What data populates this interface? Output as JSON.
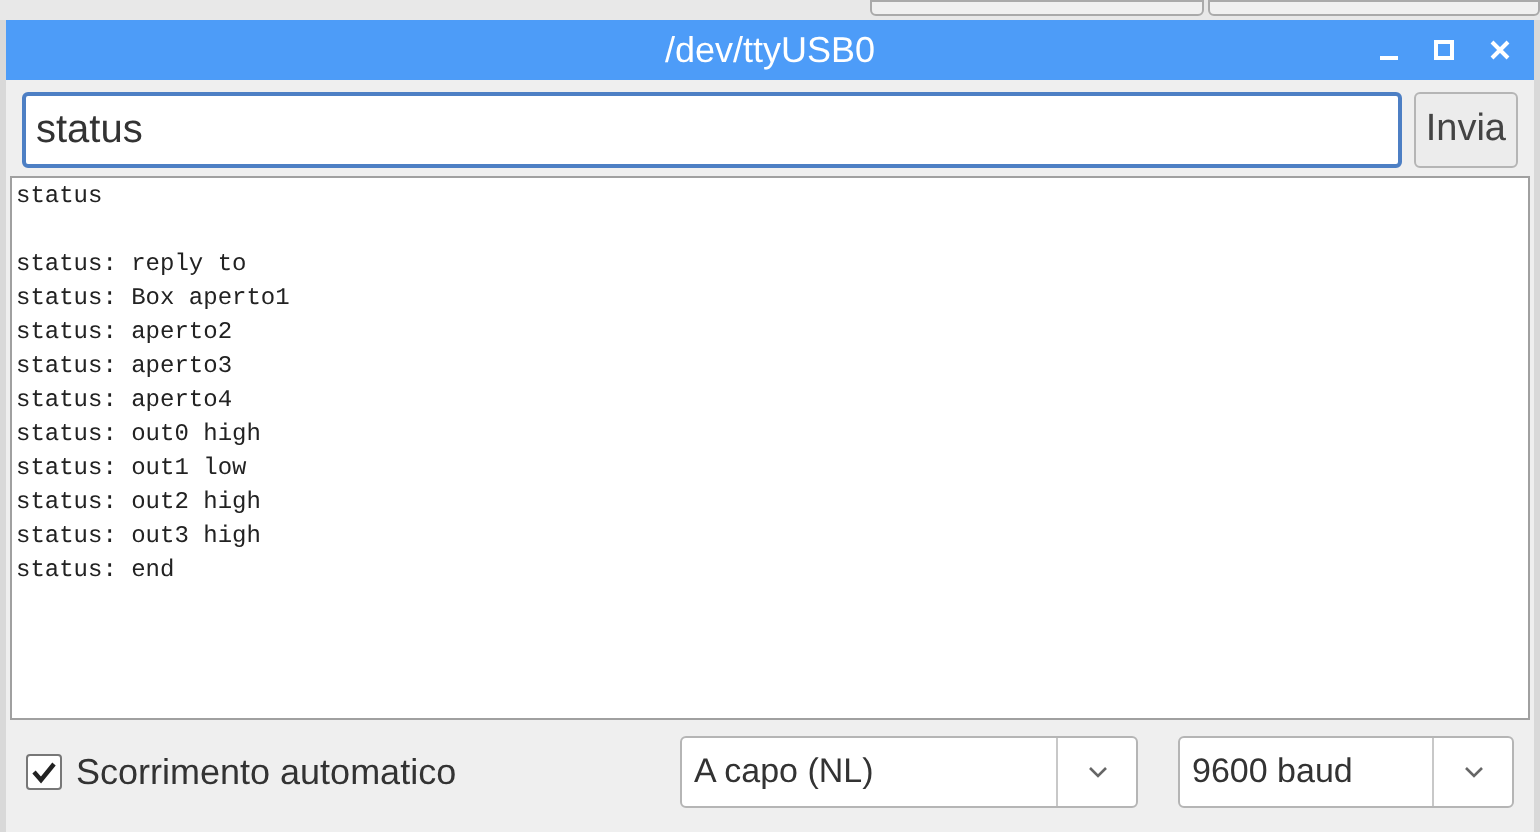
{
  "window": {
    "title": "/dev/ttyUSB0"
  },
  "send": {
    "value": "status",
    "button": "Invia"
  },
  "output": [
    {
      "kind": "echo",
      "text": "status"
    },
    {
      "kind": "reply",
      "text": "status: reply to"
    },
    {
      "kind": "reply",
      "text": "status: Box aperto1"
    },
    {
      "kind": "reply",
      "text": "status: aperto2"
    },
    {
      "kind": "reply",
      "text": "status: aperto3"
    },
    {
      "kind": "reply",
      "text": "status: aperto4"
    },
    {
      "kind": "reply",
      "text": "status: out0 high"
    },
    {
      "kind": "reply",
      "text": "status: out1 low"
    },
    {
      "kind": "reply",
      "text": "status: out2 high"
    },
    {
      "kind": "reply",
      "text": "status: out3 high"
    },
    {
      "kind": "reply",
      "text": "status: end"
    }
  ],
  "footer": {
    "autoscroll": {
      "label": "Scorrimento automatico",
      "checked": true
    },
    "line_ending": "A capo (NL)",
    "baud": "9600 baud"
  }
}
